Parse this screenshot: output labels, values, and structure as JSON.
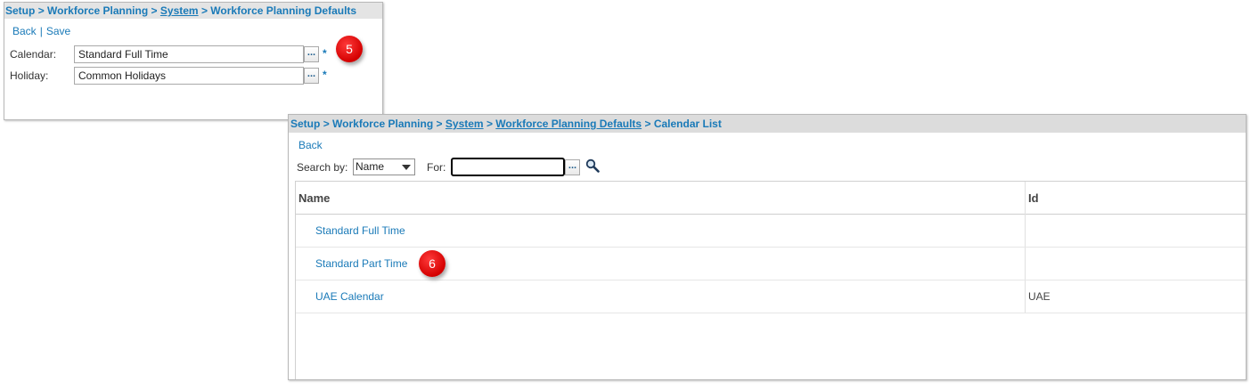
{
  "defaults_panel": {
    "breadcrumb": {
      "setup": "Setup",
      "workforce_planning": "Workforce Planning",
      "system": "System",
      "current": "Workforce Planning Defaults",
      "separator": ">"
    },
    "actions": {
      "back": "Back",
      "divider": "|",
      "save": "Save"
    },
    "fields": {
      "calendar": {
        "label": "Calendar:",
        "value": "Standard Full Time",
        "lookup": "...",
        "required": "*"
      },
      "holiday": {
        "label": "Holiday:",
        "value": "Common Holidays",
        "lookup": "...",
        "required": "*"
      }
    },
    "step_badge": "5"
  },
  "calendar_list_panel": {
    "breadcrumb": {
      "setup": "Setup",
      "workforce_planning": "Workforce Planning",
      "system": "System",
      "defaults": "Workforce Planning Defaults",
      "current": "Calendar List",
      "separator": ">"
    },
    "actions": {
      "back": "Back"
    },
    "search": {
      "search_by_label": "Search by:",
      "search_by_value": "Name",
      "for_label": "For:",
      "for_value": "",
      "lookup": "...",
      "search_icon": "magnifier-icon"
    },
    "table": {
      "columns": [
        "Name",
        "Id"
      ],
      "rows": [
        {
          "name": "Standard Full Time",
          "id": ""
        },
        {
          "name": "Standard Part Time",
          "id": ""
        },
        {
          "name": "UAE Calendar",
          "id": "UAE"
        }
      ]
    },
    "step_badge": "6"
  },
  "colors": {
    "link": "#1a7ab8",
    "breadcrumb_bg": "#e4e4e4",
    "badge": "#d40000"
  }
}
